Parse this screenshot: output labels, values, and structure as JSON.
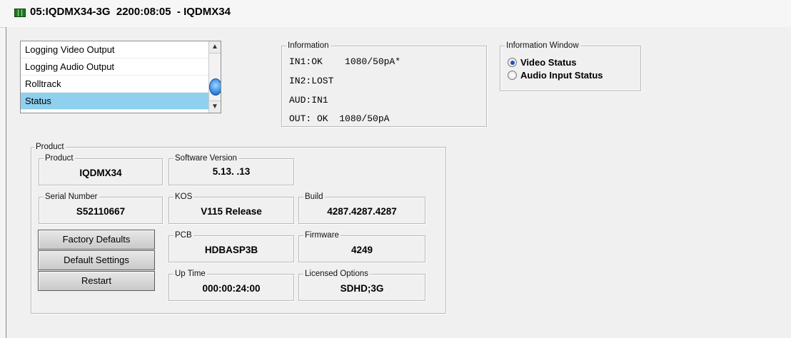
{
  "window": {
    "title": "05:IQDMX34-3G  2200:08:05  - IQDMX34"
  },
  "listbox": {
    "items": [
      {
        "label": "Logging Video Output",
        "selected": false
      },
      {
        "label": "Logging Audio Output",
        "selected": false
      },
      {
        "label": "Rolltrack",
        "selected": false
      },
      {
        "label": "Status",
        "selected": true
      }
    ]
  },
  "information": {
    "legend": "Information",
    "lines": [
      "IN1:OK    1080/50pA*",
      "IN2:LOST",
      "AUD:IN1",
      "OUT: OK  1080/50pA"
    ]
  },
  "info_window": {
    "legend": "Information Window",
    "options": [
      {
        "label": "Video Status",
        "selected": true
      },
      {
        "label": "Audio Input Status",
        "selected": false
      }
    ]
  },
  "product_panel": {
    "legend": "Product",
    "product": {
      "label": "Product",
      "value": "IQDMX34"
    },
    "software_version": {
      "label": "Software Version",
      "value": "5.13. .13"
    },
    "serial_number": {
      "label": "Serial Number",
      "value": "S52110667"
    },
    "kos": {
      "label": "KOS",
      "value": "V115 Release"
    },
    "build": {
      "label": "Build",
      "value": "4287.4287.4287"
    },
    "pcb": {
      "label": "PCB",
      "value": "HDBASP3B"
    },
    "firmware": {
      "label": "Firmware",
      "value": "4249"
    },
    "up_time": {
      "label": "Up Time",
      "value": "000:00:24:00"
    },
    "licensed_options": {
      "label": "Licensed Options",
      "value": "SDHD;3G"
    }
  },
  "buttons": {
    "factory_defaults": "Factory Defaults",
    "default_settings": "Default Settings",
    "restart": "Restart"
  },
  "colors": {
    "selection": "#8fd0ee",
    "radio_selected": "#1f4fbf",
    "title_icon": "#1f7a1f"
  },
  "icons": {
    "title": "device-icon",
    "scroll_up": "chevron-up-icon",
    "scroll_down": "chevron-down-icon"
  }
}
